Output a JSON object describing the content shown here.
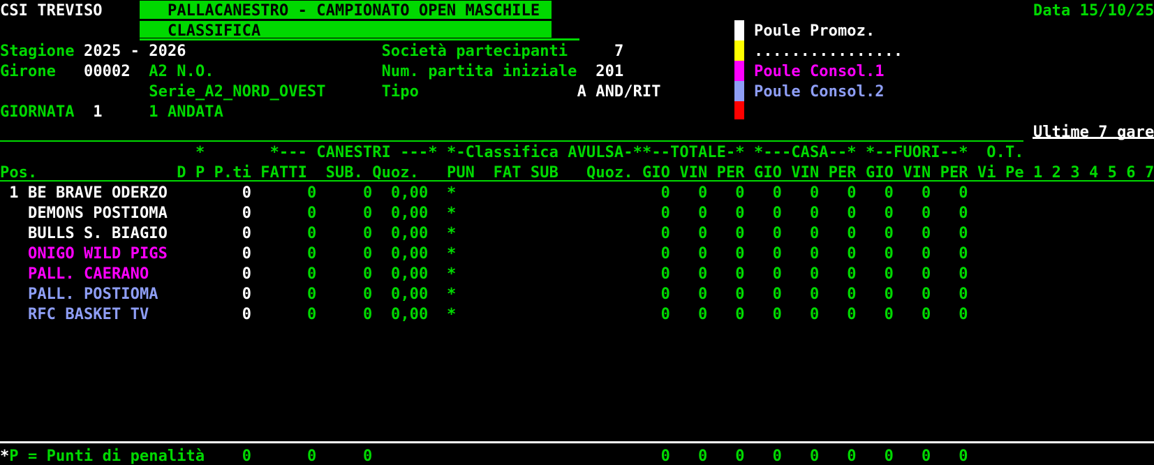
{
  "app": {
    "org": "CSI TREVISO",
    "title": "PALLACANESTRO - CAMPIONATO OPEN MASCHILE",
    "subtitle": "CLASSIFICA",
    "date_label": "Data 15/10/25"
  },
  "info": {
    "stagione_label": "Stagione",
    "stagione_value": "2025 - 2026",
    "girone_label": "Girone",
    "girone_code": "00002",
    "girone_name": "A2 N.O.",
    "girone_serie": "Serie_A2_NORD_OVEST",
    "giornata_label": "GIORNATA",
    "giornata_num": "1",
    "giornata_desc": "1 ANDATA",
    "societa_label": "Società partecipanti",
    "societa_value": "7",
    "partita_label": "Num. partita iniziale",
    "partita_value": "201",
    "tipo_label": "Tipo",
    "tipo_value": "A AND/RIT"
  },
  "legend": {
    "items": [
      {
        "swatch": "#ffffff",
        "label": "Poule Promoz.",
        "label_color": "#ffffff"
      },
      {
        "swatch": "#ffff00",
        "label": "................",
        "label_color": "#ffffff"
      },
      {
        "swatch": "#ff00ff",
        "label": "Poule Consol.1",
        "label_color": "#ff00ff"
      },
      {
        "swatch": "#8e9ef5",
        "label": "Poule Consol.2",
        "label_color": "#8e9ef5"
      },
      {
        "swatch": "#ff0000",
        "label": "",
        "label_color": "#ffffff"
      }
    ]
  },
  "table": {
    "ultime_label": "Ultime 7 gare",
    "header_groups": [
      "*",
      "*--- CANESTRI ---*",
      "*-Classifica AVULSA-*",
      "*--TOTALE-*",
      "*---CASA--*",
      "*--FUORI--*",
      "O.T."
    ],
    "header_cols": [
      "Pos.",
      "D P",
      "P.ti",
      "FATTI",
      "SUB.",
      "Quoz.",
      "PUN",
      "FAT SUB",
      "Quoz.",
      "GIO VIN PER",
      "GIO VIN PER",
      "GIO VIN PER",
      "Vi Pe",
      "1 2 3 4 5 6 7"
    ],
    "rows": [
      {
        "pos": "1",
        "name": "BE BRAVE ODERZO",
        "color": "#ffffff",
        "pti": "0",
        "fatti": "0",
        "sub": "0",
        "quoz": "0,00",
        "star": "*",
        "totale": [
          "0",
          "0",
          "0"
        ],
        "casa": [
          "0",
          "0",
          "0"
        ],
        "fuori": [
          "0",
          "0",
          "0"
        ]
      },
      {
        "pos": "",
        "name": "DEMONS POSTIOMA",
        "color": "#ffffff",
        "pti": "0",
        "fatti": "0",
        "sub": "0",
        "quoz": "0,00",
        "star": "*",
        "totale": [
          "0",
          "0",
          "0"
        ],
        "casa": [
          "0",
          "0",
          "0"
        ],
        "fuori": [
          "0",
          "0",
          "0"
        ]
      },
      {
        "pos": "",
        "name": "BULLS S. BIAGIO",
        "color": "#ffffff",
        "pti": "0",
        "fatti": "0",
        "sub": "0",
        "quoz": "0,00",
        "star": "*",
        "totale": [
          "0",
          "0",
          "0"
        ],
        "casa": [
          "0",
          "0",
          "0"
        ],
        "fuori": [
          "0",
          "0",
          "0"
        ]
      },
      {
        "pos": "",
        "name": "ONIGO WILD PIGS",
        "color": "#ff00ff",
        "pti": "0",
        "fatti": "0",
        "sub": "0",
        "quoz": "0,00",
        "star": "*",
        "totale": [
          "0",
          "0",
          "0"
        ],
        "casa": [
          "0",
          "0",
          "0"
        ],
        "fuori": [
          "0",
          "0",
          "0"
        ]
      },
      {
        "pos": "",
        "name": "PALL. CAERANO",
        "color": "#ff00ff",
        "pti": "0",
        "fatti": "0",
        "sub": "0",
        "quoz": "0,00",
        "star": "*",
        "totale": [
          "0",
          "0",
          "0"
        ],
        "casa": [
          "0",
          "0",
          "0"
        ],
        "fuori": [
          "0",
          "0",
          "0"
        ]
      },
      {
        "pos": "",
        "name": "PALL. POSTIOMA",
        "color": "#8e9ef5",
        "pti": "0",
        "fatti": "0",
        "sub": "0",
        "quoz": "0,00",
        "star": "*",
        "totale": [
          "0",
          "0",
          "0"
        ],
        "casa": [
          "0",
          "0",
          "0"
        ],
        "fuori": [
          "0",
          "0",
          "0"
        ]
      },
      {
        "pos": "",
        "name": "RFC BASKET TV",
        "color": "#8e9ef5",
        "pti": "0",
        "fatti": "0",
        "sub": "0",
        "quoz": "0,00",
        "star": "*",
        "totale": [
          "0",
          "0",
          "0"
        ],
        "casa": [
          "0",
          "0",
          "0"
        ],
        "fuori": [
          "0",
          "0",
          "0"
        ]
      }
    ]
  },
  "footer": {
    "marker": "*",
    "note": "P = Punti di penalità",
    "pti": "0",
    "fatti": "0",
    "sub": "0",
    "totale": [
      "0",
      "0",
      "0"
    ],
    "casa": [
      "0",
      "0",
      "0"
    ],
    "fuori": [
      "0",
      "0",
      "0"
    ]
  },
  "colors": {
    "terminal_green": "#00d900",
    "terminal_white": "#ffffff",
    "poule_consol1": "#ff00ff",
    "poule_consol2": "#8e9ef5",
    "banner_green": "#00d900"
  }
}
